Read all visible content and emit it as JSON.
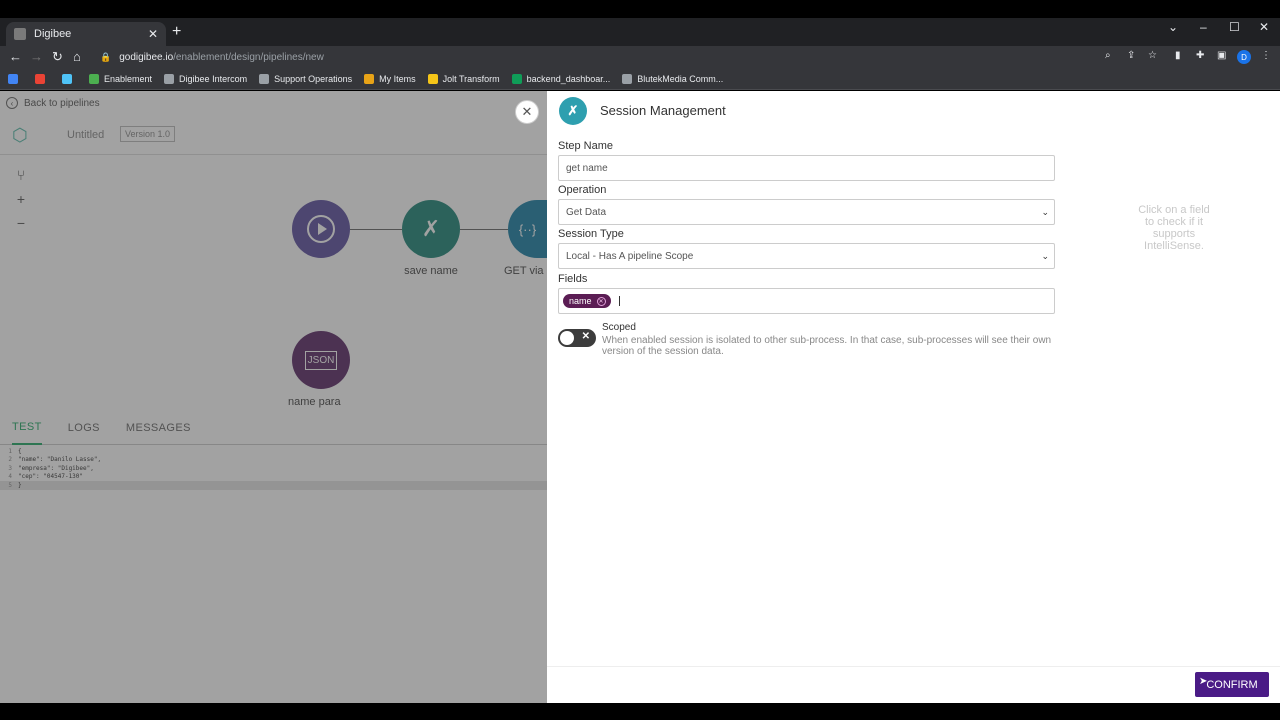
{
  "browser": {
    "tab_title": "Digibee",
    "tab_close": "✕",
    "new_tab": "+",
    "url_host": "godigibee.io",
    "url_path": "/enablement/design/pipelines/new",
    "profile_initial": "D",
    "bookmarks": [
      {
        "label": "Enablement",
        "color": "#4caf50"
      },
      {
        "label": "Digibee Intercom",
        "color": "#9aa0a6"
      },
      {
        "label": "Support Operations",
        "color": "#9aa0a6"
      },
      {
        "label": "My Items",
        "color": "#e8a317"
      },
      {
        "label": "Jolt Transform",
        "color": "#f5c518"
      },
      {
        "label": "backend_dashboar...",
        "color": "#0f9d58"
      },
      {
        "label": "BlutekMedia Comm...",
        "color": "#9aa0a6"
      }
    ]
  },
  "canvas": {
    "back_label": "Back to pipelines",
    "title": "Untitled",
    "version": "Version 1.0",
    "nodes": [
      {
        "label": "",
        "color": "#5c4fa0"
      },
      {
        "label": "save name",
        "color": "#1e8577"
      },
      {
        "label": "GET via",
        "color": "#1a7fa6"
      },
      {
        "label": "name para",
        "color": "#5b2a66"
      }
    ],
    "bottom_tabs": [
      "TEST",
      "LOGS",
      "MESSAGES"
    ],
    "code_lines": [
      {
        "num": "1",
        "text": "{"
      },
      {
        "num": "2",
        "text": "    \"name\": \"Danilo Lasse\","
      },
      {
        "num": "3",
        "text": "    \"empresa\": \"Digibee\","
      },
      {
        "num": "4",
        "text": "    \"cep\": \"04547-130\""
      },
      {
        "num": "5",
        "text": "}"
      }
    ]
  },
  "panel": {
    "title": "Session Management",
    "step_name_label": "Step Name",
    "step_name_value": "get name",
    "operation_label": "Operation",
    "operation_value": "Get Data",
    "session_type_label": "Session Type",
    "session_type_value": "Local - Has A pipeline Scope",
    "fields_label": "Fields",
    "field_chip": "name",
    "scoped_label": "Scoped",
    "scoped_desc": "When enabled session is isolated to other sub-process. In that case, sub-processes will see their own version of the session data.",
    "intellisense_hint": "Click on a field to check if it supports IntelliSense.",
    "confirm_label": "CONFIRM"
  }
}
